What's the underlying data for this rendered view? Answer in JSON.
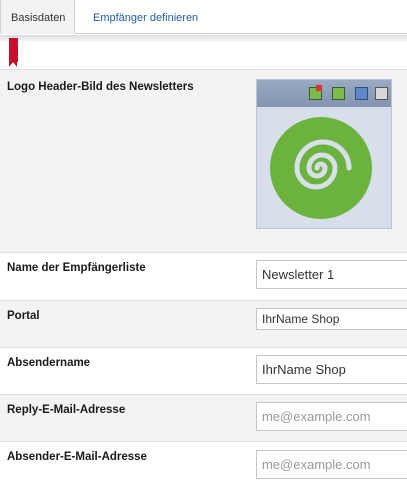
{
  "tabs": [
    {
      "label": "Basisdaten",
      "active": true
    },
    {
      "label": "Empfänger definieren",
      "active": false
    }
  ],
  "form": {
    "logo_label": "Logo Header-Bild des Newsletters",
    "logo_toolbar_icons": [
      "delete-image-icon",
      "image-icon",
      "save-icon",
      "settings-icon"
    ],
    "list_name_label": "Name der Empfängerliste",
    "list_name_value": "Newsletter 1",
    "portal_label": "Portal",
    "portal_value": "IhrName Shop",
    "sender_name_label": "Absendername",
    "sender_name_value": "IhrName Shop",
    "reply_email_label": "Reply-E-Mail-Adresse",
    "reply_email_placeholder": "me@example.com",
    "sender_email_label": "Absender-E-Mail-Adresse",
    "sender_email_placeholder": "me@example.com"
  },
  "colors": {
    "tab_link": "#1f5fa8",
    "bookmark": "#c8102e",
    "logo_green": "#6cb33e"
  }
}
